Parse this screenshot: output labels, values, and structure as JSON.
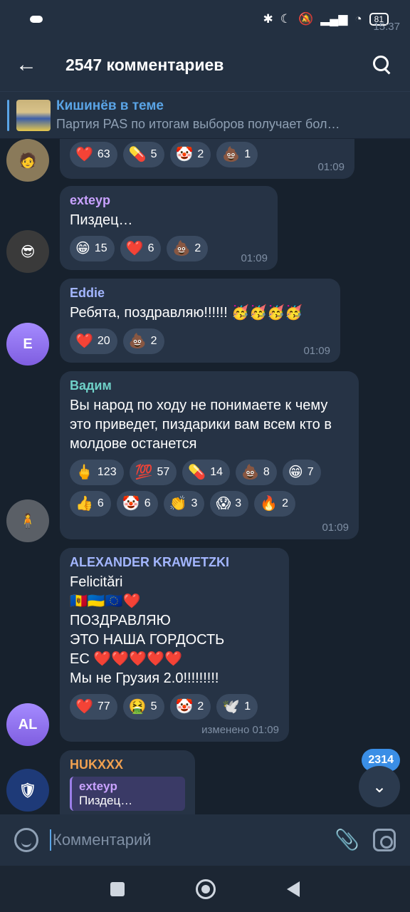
{
  "status": {
    "time": "15:37",
    "battery": "81",
    "icons": [
      "cloud-icon",
      "bluetooth-icon",
      "moon-icon",
      "mute-icon",
      "signal-icon",
      "wifi-icon",
      "battery-icon"
    ]
  },
  "header": {
    "title": "2547 комментариев",
    "back_icon": "arrow-left-icon",
    "search_icon": "search-icon"
  },
  "pinned": {
    "title": "Кишинёв в теме",
    "subtitle": "Партия PAS по итогам выборов получает бол…"
  },
  "messages": [
    {
      "id": "m0",
      "name": "",
      "text": "",
      "time": "01:09",
      "reactions": [
        {
          "emoji": "❤️",
          "count": "63"
        },
        {
          "emoji": "💊",
          "count": "5"
        },
        {
          "emoji": "🤡",
          "count": "2"
        },
        {
          "emoji": "💩",
          "count": "1"
        }
      ]
    },
    {
      "id": "m1",
      "name": "exteyp",
      "name_color": "#c9a2ff",
      "text": "Пиздец…",
      "time": "01:09",
      "reactions": [
        {
          "emoji": "😁",
          "count": "15"
        },
        {
          "emoji": "❤️",
          "count": "6"
        },
        {
          "emoji": "💩",
          "count": "2"
        }
      ]
    },
    {
      "id": "m2",
      "name": "Eddie",
      "name_color": "#a3b6ff",
      "text": "Ребята, поздравляю!!!!!! 🥳🥳🥳🥳",
      "time": "01:09",
      "avatar_letter": "E",
      "reactions": [
        {
          "emoji": "❤️",
          "count": "20"
        },
        {
          "emoji": "💩",
          "count": "2"
        }
      ]
    },
    {
      "id": "m3",
      "name": "Вадим",
      "name_color": "#6fd1c8",
      "text": "Вы народ по ходу не понимаете к чему это приведет, пиздарики вам всем кто в молдове останется",
      "time": "01:09",
      "reactions": [
        {
          "emoji": "🖕",
          "count": "123"
        },
        {
          "emoji": "💯",
          "count": "57"
        },
        {
          "emoji": "💊",
          "count": "14"
        },
        {
          "emoji": "💩",
          "count": "8"
        },
        {
          "emoji": "😁",
          "count": "7"
        },
        {
          "emoji": "👍",
          "count": "6"
        },
        {
          "emoji": "🤡",
          "count": "6"
        },
        {
          "emoji": "👏",
          "count": "3"
        },
        {
          "emoji": "😱",
          "count": "3"
        },
        {
          "emoji": "🔥",
          "count": "2"
        }
      ]
    },
    {
      "id": "m4",
      "name": "ALEXANDER KRAWETZKI",
      "name_color": "#a3b6ff",
      "lines": [
        "Felicitări",
        "🇲🇩🇺🇦🇪🇺❤️",
        "ПОЗДРАВЛЯЮ",
        "ЭТО НАША ГОРДОСТЬ",
        "ЕС ❤️❤️❤️❤️❤️",
        "Мы не Грузия 2.0!!!!!!!!!"
      ],
      "time": "изменено 01:09",
      "avatar_letter": "AL",
      "reactions": [
        {
          "emoji": "❤️",
          "count": "77"
        },
        {
          "emoji": "🤮",
          "count": "5"
        },
        {
          "emoji": "🤡",
          "count": "2"
        },
        {
          "emoji": "🕊️",
          "count": "1"
        }
      ]
    },
    {
      "id": "m5",
      "name": "HUKXXX",
      "name_color": "#f0a050",
      "reply_name": "exteyp",
      "reply_text": "Пиздец…"
    }
  ],
  "scroll": {
    "unread_count": "2314",
    "icon": "chevron-down-icon"
  },
  "composer": {
    "placeholder": "Комментарий",
    "emoji_icon": "smile-icon",
    "attach_icon": "paperclip-icon",
    "camera_icon": "camera-icon"
  },
  "nav": {
    "icons": [
      "recents-icon",
      "home-icon",
      "back-icon"
    ]
  }
}
